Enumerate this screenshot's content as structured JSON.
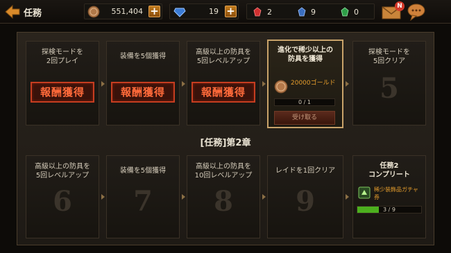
{
  "header": {
    "title": "任務",
    "coins": "551,404",
    "gems": "19",
    "red_item": "2",
    "blue_item": "9",
    "green_item": "0",
    "mail_badge": "N"
  },
  "chapter1": {
    "missions": [
      {
        "title": "探検モードを\n2回プレイ",
        "status": "報酬獲得"
      },
      {
        "title": "装備を5個獲得",
        "status": "報酬獲得"
      },
      {
        "title": "高級以上の防具を\n5回レベルアップ",
        "status": "報酬獲得"
      },
      {
        "title": "進化で稀少以上の\n防具を獲得",
        "reward": "20000ゴールド",
        "progress": "0 / 1",
        "progress_fraction": 0,
        "button": "受け取る"
      },
      {
        "title": "探検モードを\n5回クリア",
        "number": "5"
      }
    ]
  },
  "chapter2": {
    "label": "[任務]第2章",
    "missions": [
      {
        "title": "高級以上の防具を\n5回レベルアップ",
        "number": "6"
      },
      {
        "title": "装備を5個獲得",
        "number": "7"
      },
      {
        "title": "高級以上の防具を\n10回レベルアップ",
        "number": "8"
      },
      {
        "title": "レイドを1回クリア",
        "number": "9"
      }
    ],
    "completion": {
      "title": "任務2\nコンプリート",
      "reward": "稀少装飾品ガチャ券",
      "progress": "3 / 9",
      "progress_fraction": 0.333
    }
  },
  "colors": {
    "accent": "#c9a36a",
    "stamp": "#c63d20",
    "gold": "#e39b2c",
    "progress_green": "#4caf1e"
  }
}
